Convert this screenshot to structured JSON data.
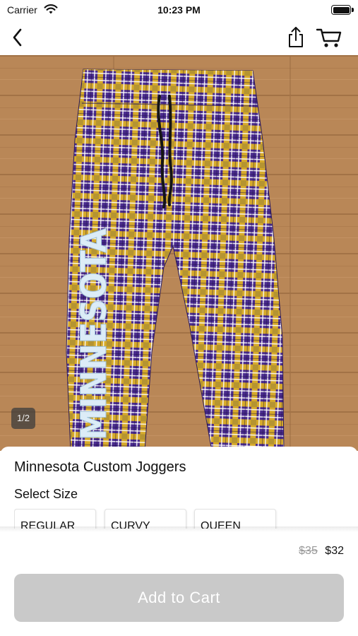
{
  "status_bar": {
    "carrier": "Carrier",
    "time": "10:23 PM"
  },
  "nav": {
    "back_icon": "chevron-left-icon",
    "share_icon": "share-icon",
    "cart_icon": "cart-icon"
  },
  "product": {
    "image_counter": "1/2",
    "image_text": "MINNESOTA",
    "title": "Minnesota Custom Joggers",
    "select_size_label": "Select Size",
    "sizes": [
      "REGULAR",
      "CURVY",
      "QUEEN"
    ],
    "old_price": "$35",
    "price": "$32"
  },
  "cta": {
    "add_to_cart_label": "Add to Cart"
  },
  "colors": {
    "plaid_purple": "#4a2b8f",
    "plaid_gold": "#e6b820",
    "floor_wood": "#b88555",
    "button_disabled": "#c9c9c9"
  }
}
